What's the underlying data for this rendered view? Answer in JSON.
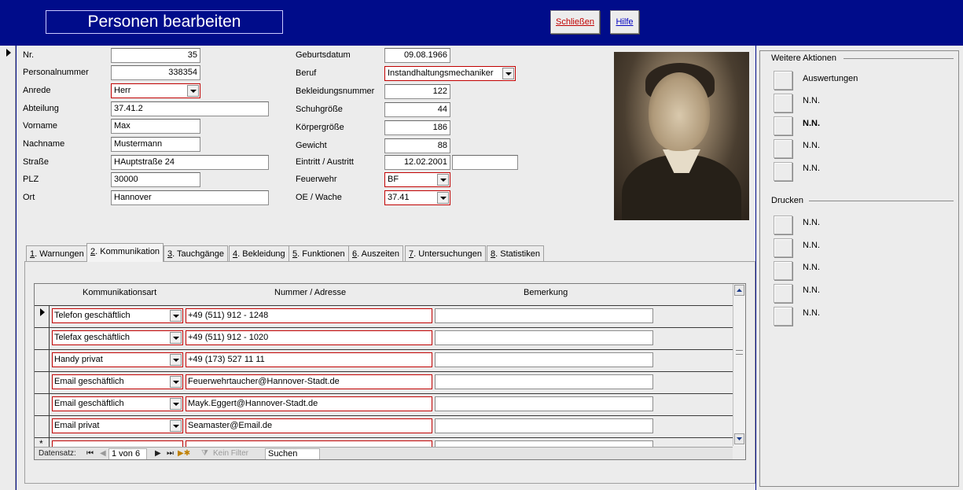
{
  "header": {
    "title": "Personen bearbeiten",
    "close_label": "Schließen",
    "help_label": "Hilfe",
    "colors": {
      "background": "#000c8a",
      "panel": "#ececec",
      "required_border": "#c00000",
      "close_text": "#c00000",
      "help_text": "#0000c0"
    }
  },
  "person": {
    "nr_label": "Nr.",
    "nr": "35",
    "personalnummer_label": "Personalnummer",
    "personalnummer": "338354",
    "anrede_label": "Anrede",
    "anrede": "Herr",
    "abteilung_label": "Abteilung",
    "abteilung": "37.41.2",
    "vorname_label": "Vorname",
    "vorname": "Max",
    "nachname_label": "Nachname",
    "nachname": "Mustermann",
    "strasse_label": "Straße",
    "strasse": "HAuptstraße 24",
    "plz_label": "PLZ",
    "plz": "30000",
    "ort_label": "Ort",
    "ort": "Hannover",
    "geburtsdatum_label": "Geburtsdatum",
    "geburtsdatum": "09.08.1966",
    "beruf_label": "Beruf",
    "beruf": "Instandhaltungsmechaniker",
    "bekleidungsnummer_label": "Bekleidungsnummer",
    "bekleidungsnummer": "122",
    "schuhgroesse_label": "Schuhgröße",
    "schuhgroesse": "44",
    "koerpergroesse_label": "Körpergröße",
    "koerpergroesse": "186",
    "gewicht_label": "Gewicht",
    "gewicht": "88",
    "eintritt_label": "Eintritt / Austritt",
    "eintritt": "12.02.2001",
    "austritt": "",
    "feuerwehr_label": "Feuerwehr",
    "feuerwehr": "BF",
    "wache_label": "OE / Wache",
    "wache": "37.41"
  },
  "actions": {
    "weitere_title": "Weitere Aktionen",
    "weitere": [
      "Auswertungen",
      "N.N.",
      "N.N.",
      "N.N.",
      "N.N."
    ],
    "drucken_title": "Drucken",
    "drucken": [
      "N.N.",
      "N.N.",
      "N.N.",
      "N.N.",
      "N.N."
    ]
  },
  "tabs": [
    {
      "key": "1",
      "label": ". Warnungen"
    },
    {
      "key": "2",
      "label": ". Kommunikation"
    },
    {
      "key": "3",
      "label": ". Tauchgänge"
    },
    {
      "key": "4",
      "label": ". Bekleidung"
    },
    {
      "key": "5",
      "label": ". Funktionen"
    },
    {
      "key": "6",
      "label": ". Auszeiten"
    },
    {
      "key": "7",
      "label": ". Untersuchungen"
    },
    {
      "key": "8",
      "label": ". Statistiken"
    }
  ],
  "kommunikation": {
    "columns": [
      "Kommunikationsart",
      "Nummer / Adresse",
      "Bemerkung"
    ],
    "rows": [
      {
        "art": "Telefon geschäftlich",
        "nummer": "+49 (511) 912 - 1248",
        "bemerkung": ""
      },
      {
        "art": "Telefax geschäftlich",
        "nummer": "+49 (511) 912 - 1020",
        "bemerkung": ""
      },
      {
        "art": "Handy privat",
        "nummer": "+49 (173) 527 11 11",
        "bemerkung": ""
      },
      {
        "art": "Email geschäftlich",
        "nummer": "Feuerwehrtaucher@Hannover-Stadt.de",
        "bemerkung": ""
      },
      {
        "art": "Email geschäftlich",
        "nummer": "Mayk.Eggert@Hannover-Stadt.de",
        "bemerkung": ""
      },
      {
        "art": "Email privat",
        "nummer": "Seamaster@Email.de",
        "bemerkung": ""
      }
    ],
    "new_row_marker": "*"
  },
  "navigation": {
    "label": "Datensatz:",
    "position": "1 von 6",
    "filter_label": "Kein Filter",
    "search_placeholder": "Suchen"
  }
}
